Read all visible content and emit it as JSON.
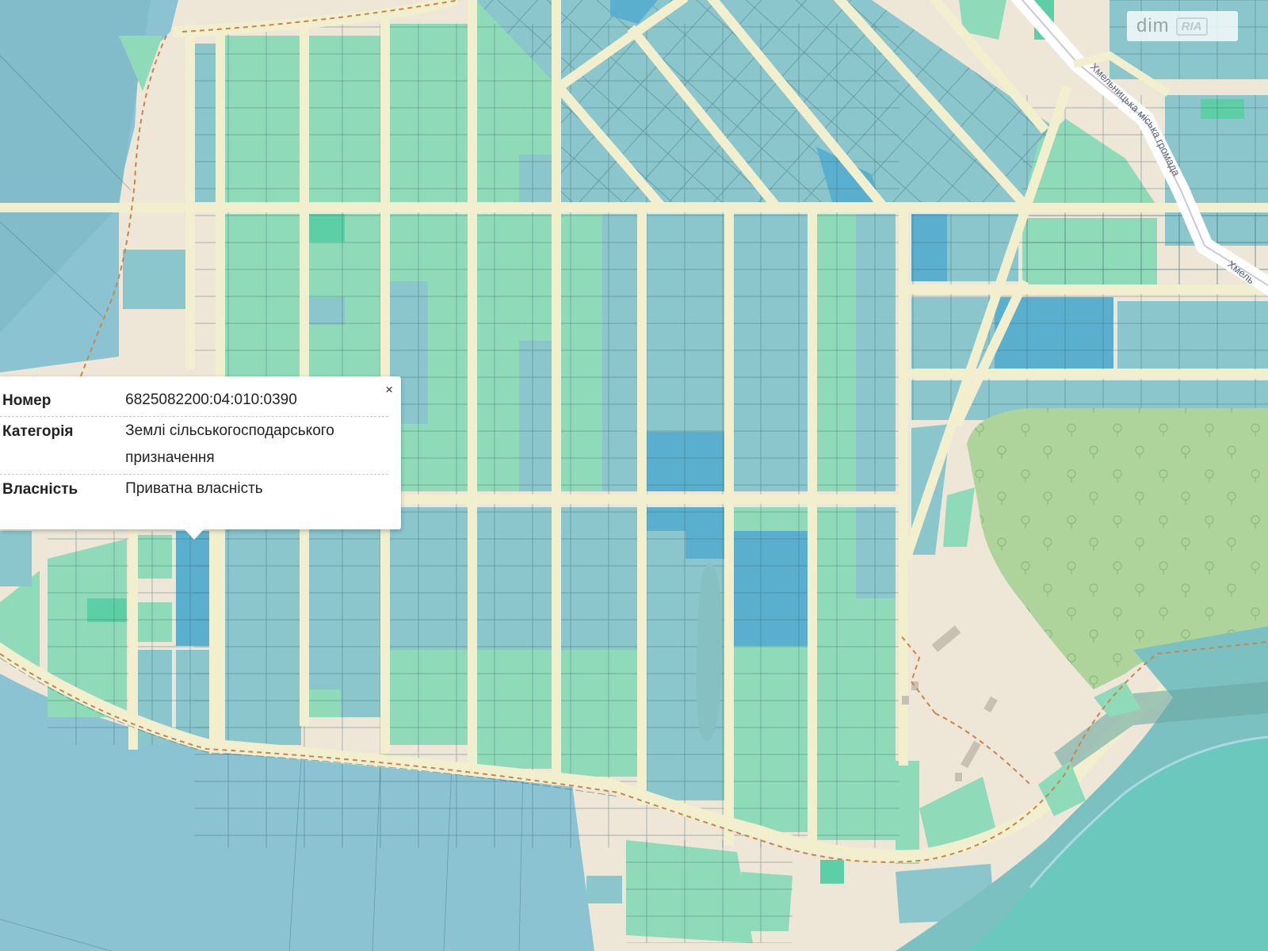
{
  "map": {
    "colors": {
      "background": "#eee7d7",
      "field": "#8cc3d2",
      "parcel_green": "#8fdbb9",
      "parcel_teal": "#8bc6cc",
      "parcel_blue": "#5aafce",
      "parcel_bright": "#5ccfa6",
      "forest": "#aed49c",
      "water": "#6bc8bc",
      "road": "#f2efcf",
      "boundary": "#c8864a"
    },
    "road_label": "Хмельницька міська громада",
    "road_label_partial": "Хмель"
  },
  "popup": {
    "close_icon": "close-icon",
    "close_glyph": "×",
    "rows": [
      {
        "key": "Номер",
        "value": "6825082200:04:010:0390"
      },
      {
        "key": "Категорія",
        "value": "Землі сільськогосподарського призначення"
      },
      {
        "key": "Власність",
        "value": "Приватна власність"
      }
    ]
  },
  "watermark": {
    "text1": "dim",
    "text2": "RIA"
  }
}
